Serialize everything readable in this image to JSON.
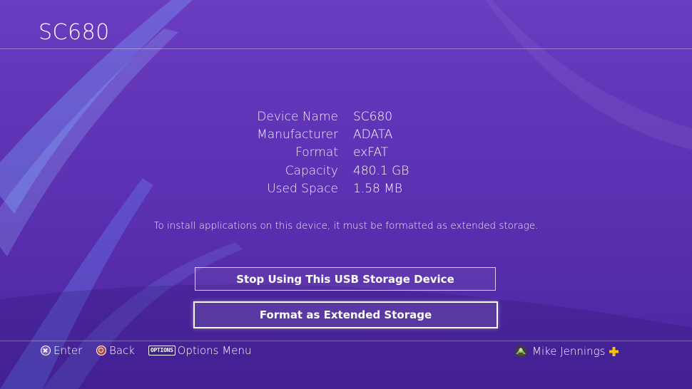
{
  "header": {
    "title": "SC680"
  },
  "device_info": [
    {
      "label": "Device Name",
      "value": "SC680"
    },
    {
      "label": "Manufacturer",
      "value": "ADATA"
    },
    {
      "label": "Format",
      "value": "exFAT"
    },
    {
      "label": "Capacity",
      "value": "480.1 GB"
    },
    {
      "label": "Used Space",
      "value": "1.58 MB"
    }
  ],
  "note": "To install applications on this device, it must be formatted as extended storage.",
  "buttons": {
    "stop": "Stop Using This USB Storage Device",
    "format": "Format as Extended Storage"
  },
  "footer": {
    "enter": {
      "icon": "cross-button-icon",
      "label": "Enter"
    },
    "back": {
      "icon": "circle-button-icon",
      "label": "Back"
    },
    "options": {
      "icon_text": "OPTIONS",
      "label": "Options Menu"
    },
    "user": {
      "name": "Mike Jennings",
      "plus_color": "#f5c400"
    }
  },
  "colors": {
    "background": "#5a2fb0",
    "accent": "#ffffff"
  }
}
